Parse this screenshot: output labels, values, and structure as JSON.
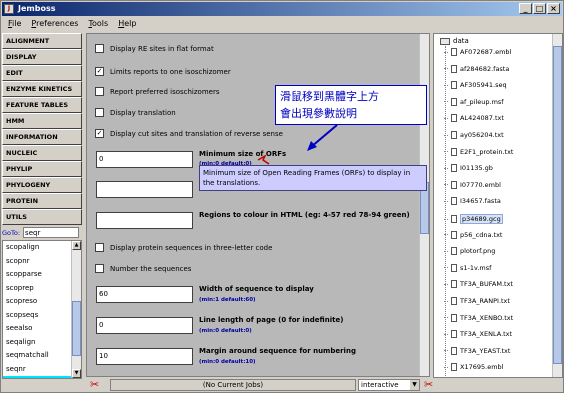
{
  "window": {
    "title": "Jemboss"
  },
  "menu": [
    "File",
    "Preferences",
    "Tools",
    "Help"
  ],
  "categories": [
    "ALIGNMENT",
    "DISPLAY",
    "EDIT",
    "ENZYME KINETICS",
    "FEATURE TABLES",
    "HMM",
    "INFORMATION",
    "NUCLEIC",
    "PHYLIP",
    "PHYLOGENY",
    "PROTEIN",
    "UTILS"
  ],
  "goto": {
    "label": "GoTo:",
    "value": "seqr"
  },
  "programs": [
    "scopalign",
    "scopnr",
    "scopparse",
    "scoprep",
    "scopreso",
    "scopseqs",
    "seealso",
    "seqalign",
    "seqmatchall",
    "seqnr",
    "seqret"
  ],
  "selected_program": "seqret",
  "options": {
    "opt1": {
      "label": "Display RE sites in flat format",
      "checked": false
    },
    "opt2": {
      "label": "Limits reports to one isoschizomer",
      "checked": true
    },
    "opt3": {
      "label": "Report preferred isoschizomers",
      "checked": false
    },
    "opt4": {
      "label": "Display translation",
      "checked": false
    },
    "opt5": {
      "label": "Display cut sites and translation of reverse sense",
      "checked": true
    },
    "opt6": {
      "label": "Display protein sequences in three-letter code",
      "checked": false
    },
    "opt7": {
      "label": "Number the sequences",
      "checked": false
    }
  },
  "fields": {
    "orf": {
      "value": "0",
      "label": "Minimum size of ORFs",
      "hint": "(min:0 default:0)"
    },
    "f2": {
      "value": ""
    },
    "regions": {
      "value": "",
      "label": "Regions to colour in HTML (eg: 4-57 red 78-94 green)"
    },
    "width": {
      "value": "60",
      "label": "Width of sequence to display",
      "hint": "(min:1 default:60)"
    },
    "length": {
      "value": "0",
      "label": "Line length of page (0 for indefinite)",
      "hint": "(min:0 default:0)"
    },
    "margin": {
      "value": "10",
      "label": "Margin around sequence for numbering",
      "hint": "(min:0 default:10)"
    }
  },
  "tooltip": {
    "line1": "Minimum size of Open Reading Frames (ORFs) to display in",
    "line2": "the translations."
  },
  "annotation": {
    "line1": "滑鼠移到黑體字上方",
    "line2": "會出現參數說明"
  },
  "file_tree": {
    "root": "data",
    "files": [
      "AF072687.embl",
      "af284682.fasta",
      "AF305941.seq",
      "af_pileup.msf",
      "AL424087.txt",
      "ay056204.txt",
      "E2F1_protein.txt",
      "I01135.gb",
      "I07770.embl",
      "I34657.fasta",
      "p34689.gcg",
      "p56_cdna.txt",
      "plotorf.png",
      "s1-1v.msf",
      "TF3A_BUFAM.txt",
      "TF3A_RANPI.txt",
      "TF3A_XENBO.txt",
      "TF3A_XENLA.txt",
      "TF3A_YEAST.txt",
      "X17695.embl"
    ],
    "selected": "p34689.gcg"
  },
  "status": {
    "jobs": "(No Current Jobs)",
    "mode": "interactive"
  },
  "colors": {
    "title_start": "#0a246a",
    "selected_program": "#00e5ff",
    "annotation": "#0000c0",
    "tooltip_bg": "#ccccff"
  }
}
